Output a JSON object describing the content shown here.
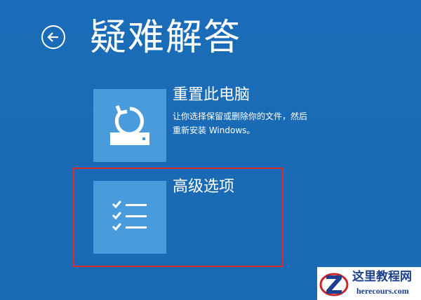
{
  "header": {
    "title": "疑难解答",
    "back_icon": "back-arrow-icon"
  },
  "options": [
    {
      "title": "重置此电脑",
      "description_lines": [
        "让你选择保留或删除你的文件，然后",
        "重新安装 Windows。"
      ],
      "icon": "reset-pc-icon"
    },
    {
      "title": "高级选项",
      "icon": "checklist-icon",
      "highlighted": true
    }
  ],
  "watermark": {
    "name": "这里教程网",
    "url": "herecours.com"
  },
  "colors": {
    "background": "#1a6bb5",
    "tile": "#4a9bdb",
    "highlight": "#e02a2a",
    "watermark_text": "#1c3f8f"
  }
}
